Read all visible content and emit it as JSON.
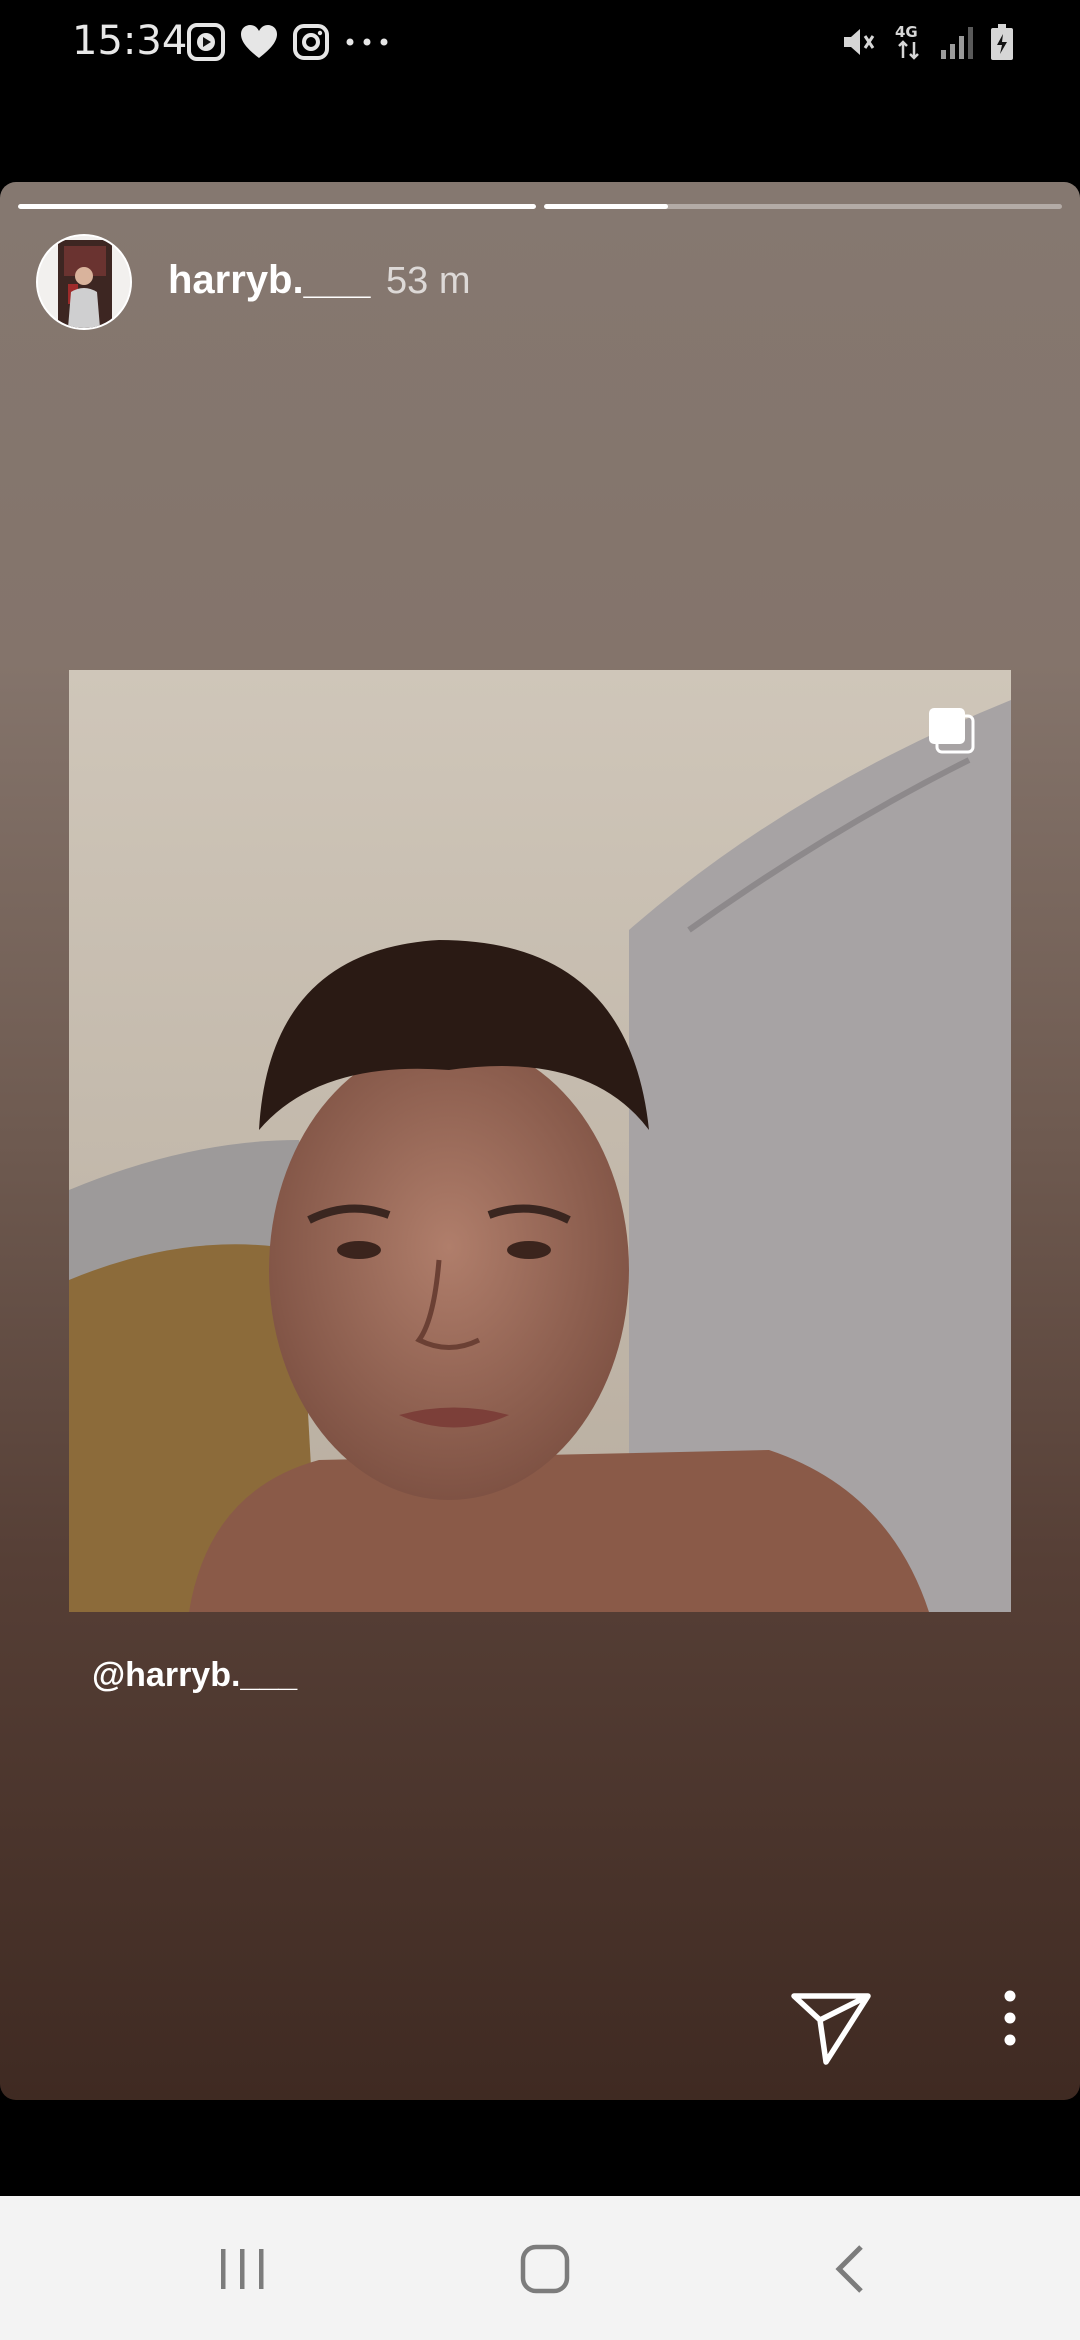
{
  "status_bar": {
    "time": "15:34",
    "left_icons": [
      "youtube-icon",
      "heart-icon",
      "instagram-icon",
      "more-dots-icon"
    ],
    "right_icons": [
      "mute-icon",
      "4g-icon",
      "signal-icon",
      "battery-icon"
    ],
    "network_label": "4G"
  },
  "story": {
    "progress_segments": [
      1.0,
      0.24
    ],
    "username": "harryb.___",
    "time_ago": "53 m",
    "mention": "@harryb.___"
  },
  "colors": {
    "background": "#000000",
    "story_top": "#857870",
    "story_bottom": "#3f2a22",
    "nav_bar": "#f3f3f3"
  },
  "icons": {
    "send": "send-icon",
    "more": "more-vertical-icon",
    "multi": "multiple-photos-icon",
    "nav_recent": "recents-icon",
    "nav_home": "home-icon",
    "nav_back": "back-icon"
  }
}
